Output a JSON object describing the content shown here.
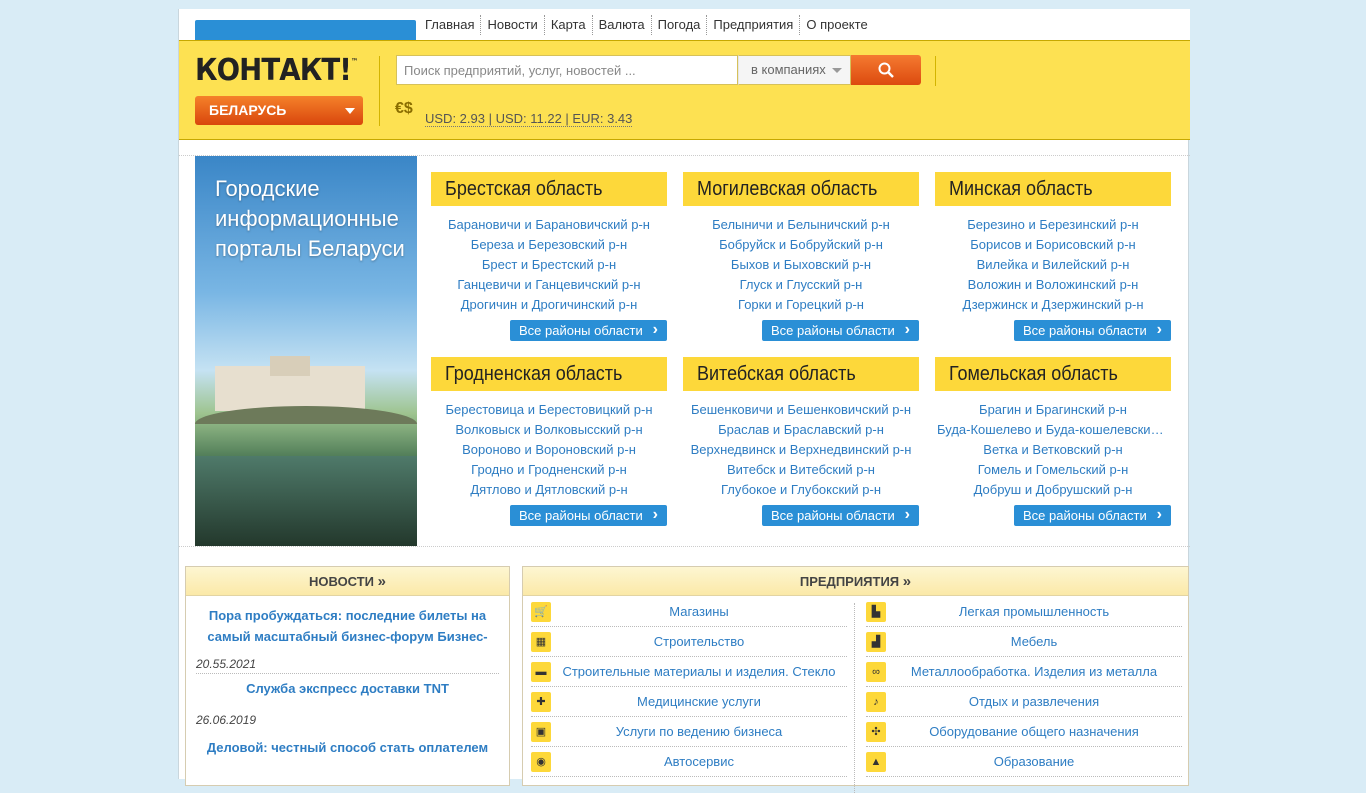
{
  "nav": [
    "Главная",
    "Новости",
    "Карта",
    "Валюта",
    "Погода",
    "Предприятия",
    "О проекте"
  ],
  "header": {
    "logo": "КОНТАКТ!",
    "logo_tm": "™",
    "country": "БЕЛАРУСЬ",
    "search_placeholder": "Поиск предприятий, услуг, новостей ...",
    "search_scope": "в компаниях",
    "rates": "USD: 2.93 | USD: 11.22 | EUR: 3.43",
    "currency_icon": "€$"
  },
  "banner": {
    "title": "Городские информационные порталы Беларуси"
  },
  "regions": [
    {
      "title": "Брестская область",
      "districts": [
        "Барановичи и Барановичский р-н",
        "Береза и Березовский р-н",
        "Брест и Брестский р-н",
        "Ганцевичи и Ганцевичский р-н",
        "Дрогичин и Дрогичинский р-н"
      ],
      "all": "Все районы области"
    },
    {
      "title": "Могилевская область",
      "districts": [
        "Белыничи и Белыничский р-н",
        "Бобруйск и Бобруйский р-н",
        "Быхов и Быховский р-н",
        "Глуск и Глусский р-н",
        "Горки и Горецкий р-н"
      ],
      "all": "Все районы области"
    },
    {
      "title": "Минская область",
      "districts": [
        "Березино и Березинский р-н",
        "Борисов и Борисовский р-н",
        "Вилейка и Вилейский р-н",
        "Воложин и Воложинский р-н",
        "Дзержинск и Дзержинский р-н"
      ],
      "all": "Все районы области"
    },
    {
      "title": "Гродненская область",
      "districts": [
        "Берестовица и Берестовицкий р-н",
        "Волковыск и Волковысский р-н",
        "Вороново и Вороновский р-н",
        "Гродно и Гродненский р-н",
        "Дятлово и Дятловский р-н"
      ],
      "all": "Все районы области"
    },
    {
      "title": "Витебская область",
      "districts": [
        "Бешенковичи и Бешенковичский р-н",
        "Браслав и Браславский р-н",
        "Верхнедвинск и Верхнедвинский р-н",
        "Витебск и Витебский р-н",
        "Глубокое и Глубокский р-н"
      ],
      "all": "Все районы области"
    },
    {
      "title": "Гомельская область",
      "districts": [
        "Брагин и Брагинский р-н",
        "Буда-Кошелево и Буда-кошелевский р-н",
        "Ветка и Ветковский р-н",
        "Гомель и Гомельский р-н",
        "Добруш и Добрушский р-н"
      ],
      "all": "Все районы области"
    }
  ],
  "news": {
    "title": "НОВОСТИ",
    "chev": "»",
    "items": [
      {
        "title": "Пора пробуждаться: последние билеты на самый масштабный бизнес-форум Бизнес-",
        "date": "20.55.2021"
      },
      {
        "title": "Служба экспресс доставки TNT",
        "date": "26.06.2019"
      },
      {
        "title": "Деловой: честный способ стать оплателем",
        "date": ""
      }
    ]
  },
  "business": {
    "title": "ПРЕДПРИЯТИЯ",
    "chev": "»",
    "left": [
      {
        "label": "Магазины",
        "icon": "cart-icon",
        "glyph": "🛒"
      },
      {
        "label": "Строительство",
        "icon": "building-icon",
        "glyph": "▦"
      },
      {
        "label": "Строительные материалы и изделия. Стекло",
        "icon": "paint-roller-icon",
        "glyph": "▬"
      },
      {
        "label": "Медицинские услуги",
        "icon": "medical-cross-icon",
        "glyph": "✚"
      },
      {
        "label": "Услуги по ведению бизнеса",
        "icon": "briefcase-icon",
        "glyph": "▣"
      },
      {
        "label": "Автосервис",
        "icon": "car-icon",
        "glyph": "◉"
      }
    ],
    "right": [
      {
        "label": "Легкая промышленность",
        "icon": "boot-icon",
        "glyph": "▙"
      },
      {
        "label": "Мебель",
        "icon": "armchair-icon",
        "glyph": "▟"
      },
      {
        "label": "Металлообработка. Изделия из металла",
        "icon": "chain-icon",
        "glyph": "∞"
      },
      {
        "label": "Отдых и развлечения",
        "icon": "music-note-icon",
        "glyph": "♪"
      },
      {
        "label": "Оборудование общего назначения",
        "icon": "fan-icon",
        "glyph": "✣"
      },
      {
        "label": "Образование",
        "icon": "graduation-cap-icon",
        "glyph": "▲"
      }
    ]
  }
}
